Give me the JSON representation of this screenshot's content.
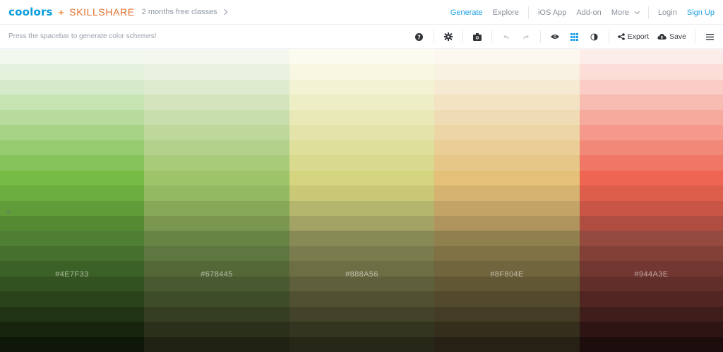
{
  "nav": {
    "logo": "coolors",
    "plus": "+",
    "partner": "SKILLSHARE",
    "promo": "2 months free classes",
    "links": {
      "generate": "Generate",
      "explore": "Explore",
      "ios_app": "iOS App",
      "addon": "Add-on",
      "more": "More",
      "login": "Login",
      "signup": "Sign Up"
    }
  },
  "toolbar": {
    "hint": "Press the spacebar to generate color schemes!",
    "export_label": "Export",
    "save_label": "Save"
  },
  "colors": {
    "nav_active": "#1ea1e4",
    "brand": "#0a9cdb",
    "skillshare": "#e06f2c"
  },
  "palette": [
    {
      "hex": "#4E7F33",
      "shades": [
        "#F1F8EE",
        "#E4F1DD",
        "#D5EAC8",
        "#C6E3B2",
        "#B6DB9C",
        "#A6D386",
        "#96CB70",
        "#86C35A",
        "#76BB44",
        "#6BAD3E",
        "#609C38",
        "#558A32",
        "#4E7F33",
        "#45702D",
        "#3C6127",
        "#335221",
        "#2A431B",
        "#203415",
        "#17250F",
        "#0E1709"
      ]
    },
    {
      "hex": "#678445",
      "shades": [
        "#F3F7EE",
        "#E9F1DF",
        "#DFEBCF",
        "#D4E5BE",
        "#C9DEAD",
        "#BED89C",
        "#B3D18B",
        "#A8CB7A",
        "#9DC469",
        "#93B963",
        "#87A859",
        "#7B964F",
        "#678445",
        "#5E763F",
        "#546837",
        "#4A5A30",
        "#3F4C29",
        "#353E22",
        "#2A301A",
        "#202213"
      ]
    },
    {
      "hex": "#888A56",
      "shades": [
        "#FBFBEF",
        "#F7F7E2",
        "#F3F3D4",
        "#EEEEC6",
        "#E9E9B8",
        "#E4E4AA",
        "#DFDF9C",
        "#DADA8E",
        "#D5D580",
        "#C8C877",
        "#B5B66E",
        "#A2A364",
        "#888A56",
        "#7A7C4D",
        "#6C6E44",
        "#5E5F3B",
        "#505132",
        "#424329",
        "#343520",
        "#262717"
      ]
    },
    {
      "hex": "#8F804E",
      "shades": [
        "#FCF8F0",
        "#F9F1E1",
        "#F6EAD2",
        "#F3E3C3",
        "#F0DCB4",
        "#EDD5A5",
        "#EACE96",
        "#E7C787",
        "#E4C078",
        "#D5B370",
        "#C3A466",
        "#B0945D",
        "#8F804E",
        "#807245",
        "#71653D",
        "#625735",
        "#53492C",
        "#443C24",
        "#352E1C",
        "#262114"
      ]
    },
    {
      "hex": "#944A3E",
      "shades": [
        "#FDEDEA",
        "#FCDDD8",
        "#FACCC5",
        "#F8BBB1",
        "#F6AA9E",
        "#F4998B",
        "#F28878",
        "#F07765",
        "#EE6652",
        "#DD5E4B",
        "#C85546",
        "#B04D41",
        "#944A3E",
        "#834037",
        "#723730",
        "#612E29",
        "#502522",
        "#3F1D1B",
        "#2E1514",
        "#1E0D0D"
      ]
    }
  ]
}
